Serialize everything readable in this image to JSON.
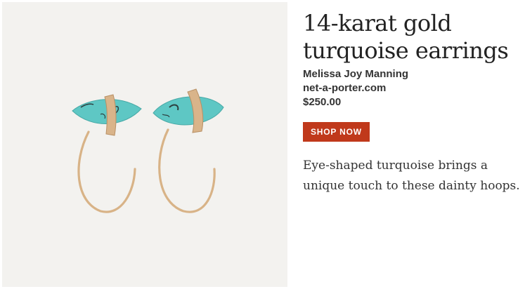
{
  "product": {
    "title": "14-karat gold turquoise earrings",
    "brand": "Melissa Joy Manning",
    "retailer": "net-a-porter.com",
    "price": "$250.00",
    "cta_label": "SHOP NOW",
    "description": "Eye-shaped turquoise brings a unique touch to these dainty hoops."
  },
  "colors": {
    "image_background": "#f3f2ef",
    "cta_background": "#c0391b",
    "turquoise": "#5ec7c4",
    "gold": "#d9b48a"
  }
}
